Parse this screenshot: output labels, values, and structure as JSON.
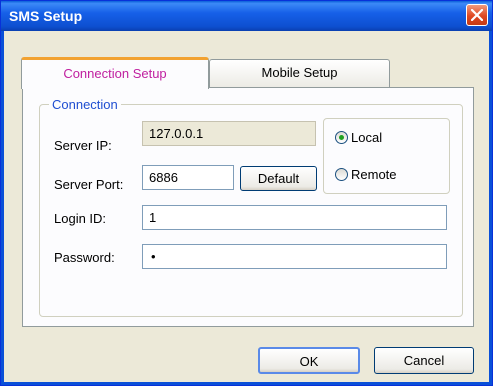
{
  "window": {
    "title": "SMS Setup"
  },
  "tabs": [
    {
      "label": "Connection Setup",
      "active": true
    },
    {
      "label": "Mobile Setup",
      "active": false
    }
  ],
  "connection": {
    "legend": "Connection",
    "server_ip_label": "Server IP:",
    "server_ip_value": "127.0.0.1",
    "server_port_label": "Server Port:",
    "server_port_value": "6886",
    "default_button": "Default",
    "login_id_label": "Login ID:",
    "login_id_value": "1",
    "password_label": "Password:",
    "password_value": "•",
    "mode": {
      "options": [
        {
          "label": "Local",
          "selected": true
        },
        {
          "label": "Remote",
          "selected": false
        }
      ]
    }
  },
  "footer": {
    "ok_label": "OK",
    "cancel_label": "Cancel"
  },
  "colors": {
    "titlebar": "#0d4fd0",
    "active_tab_text": "#c020a0",
    "active_tab_accent": "#f2a231",
    "group_legend": "#1f4ed1",
    "radio_selected": "#21a121",
    "close_button": "#e04822"
  }
}
